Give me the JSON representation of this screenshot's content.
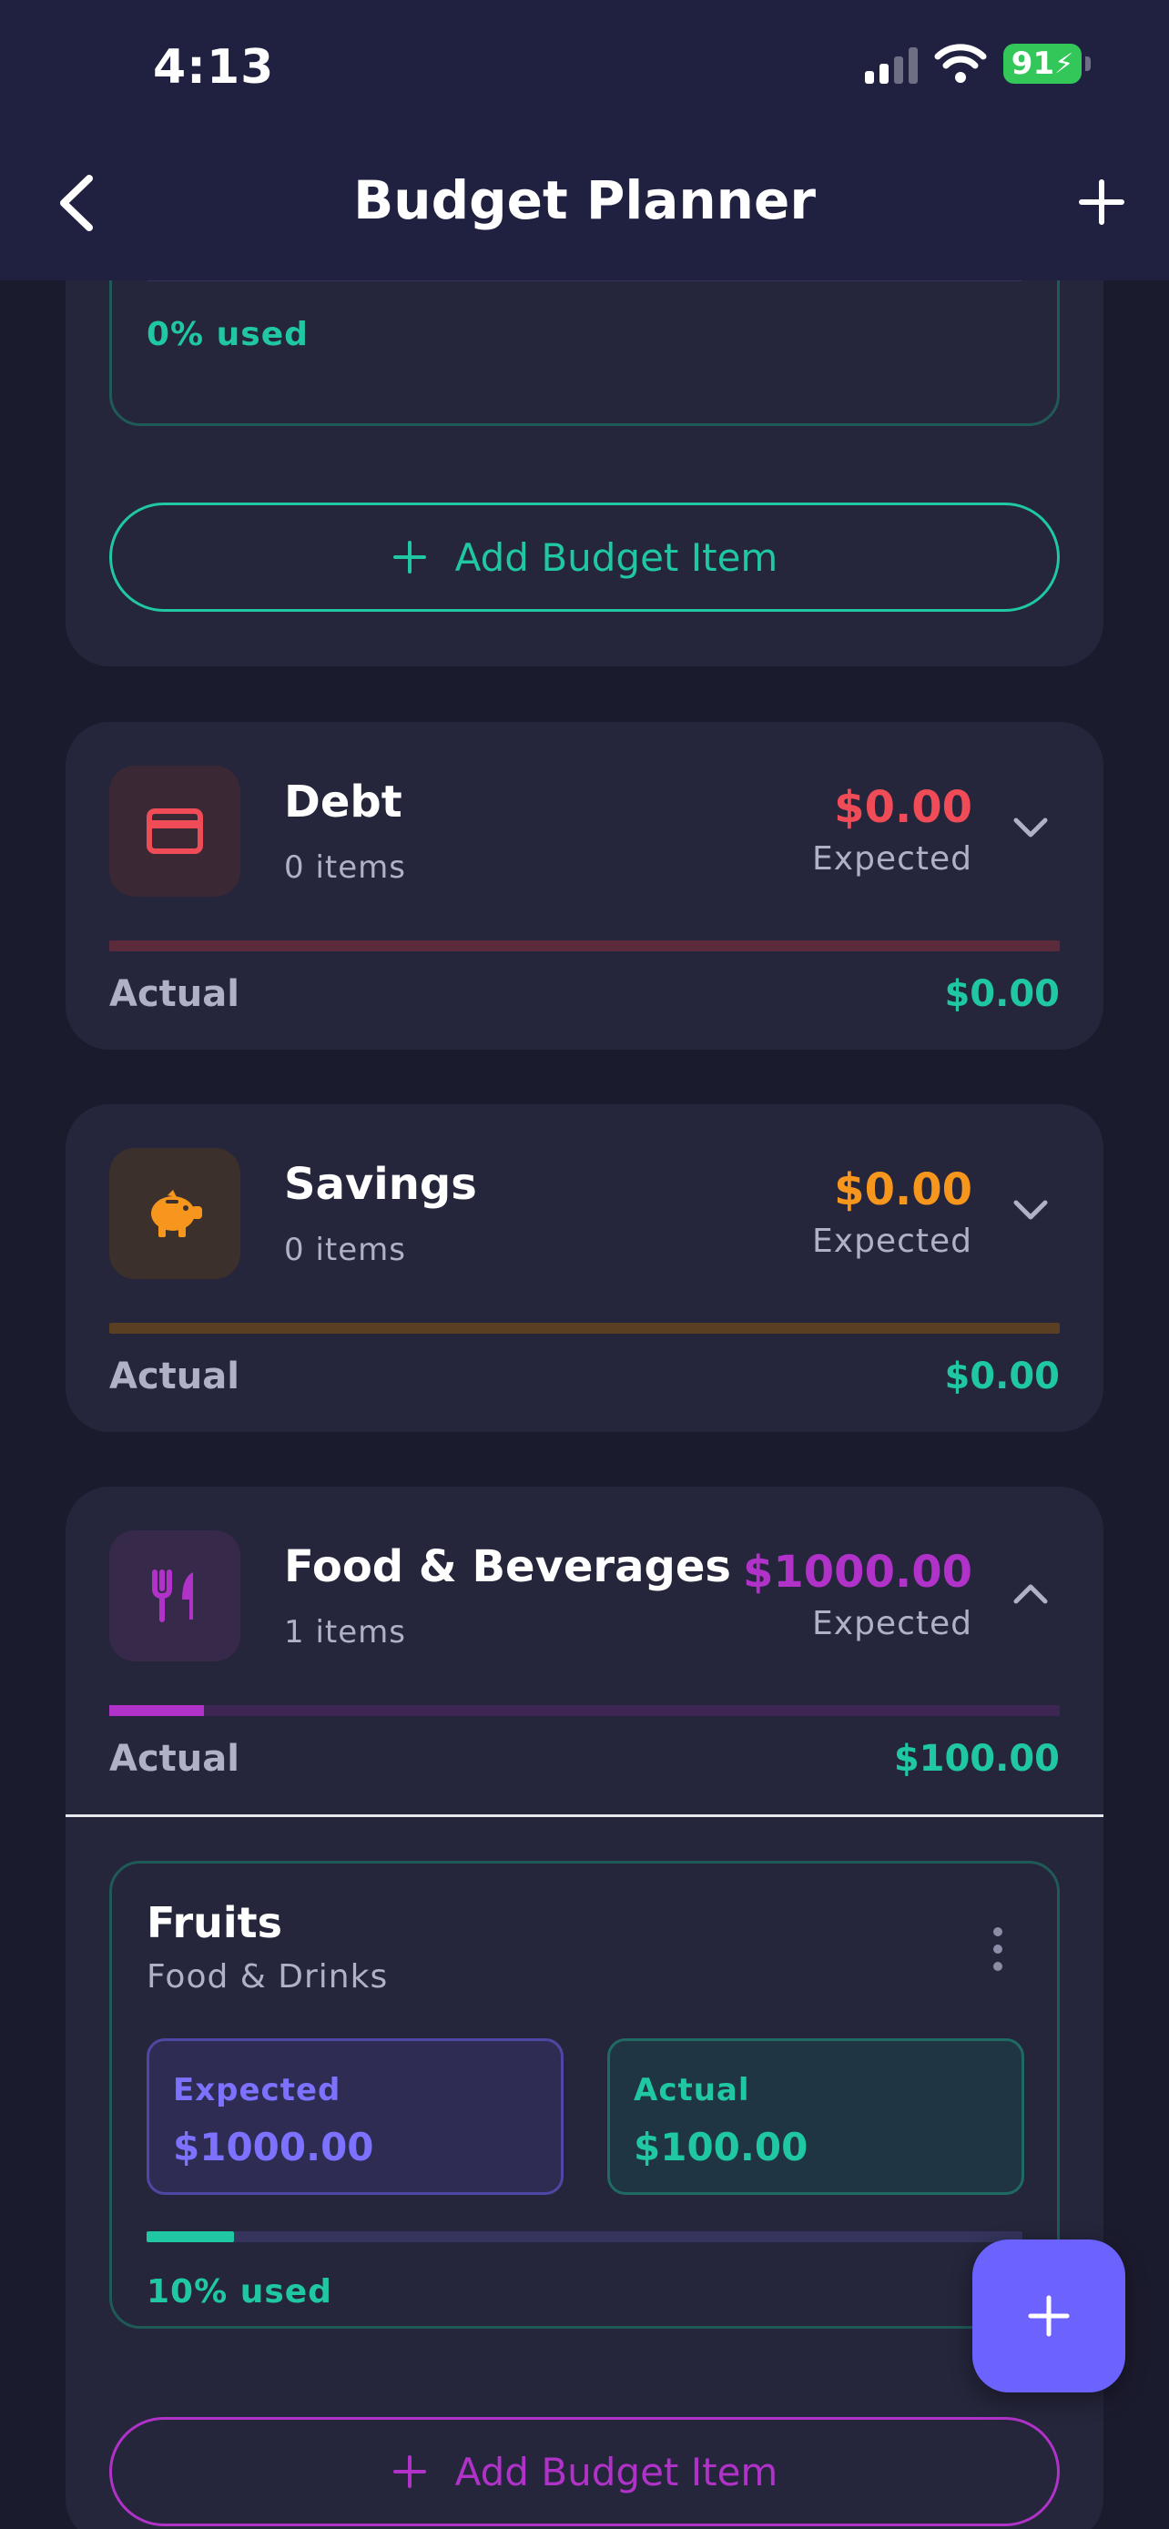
{
  "status_bar": {
    "time": "4:13",
    "battery": "91"
  },
  "nav": {
    "title": "Budget Planner",
    "back_icon": "chevron-left-icon",
    "add_icon": "plus-icon"
  },
  "top_partial": {
    "used_text": "0% used",
    "add_label": "Add Budget Item"
  },
  "categories": [
    {
      "name": "Debt",
      "count": "0 items",
      "expected": "$0.00",
      "expected_label": "Expected",
      "actual_label": "Actual",
      "actual": "$0.00",
      "icon": "credit-card-icon",
      "accent": "#ef4c57",
      "progress": 0,
      "expanded": false
    },
    {
      "name": "Savings",
      "count": "0 items",
      "expected": "$0.00",
      "expected_label": "Expected",
      "actual_label": "Actual",
      "actual": "$0.00",
      "icon": "piggy-bank-icon",
      "accent": "#f7961d",
      "progress": 0,
      "expanded": false
    },
    {
      "name": "Food & Beverages",
      "count": "1 items",
      "expected": "$1000.00",
      "expected_label": "Expected",
      "actual_label": "Actual",
      "actual": "$100.00",
      "icon": "fork-knife-icon",
      "accent": "#b032c8",
      "progress": 0.1,
      "expanded": true,
      "items": [
        {
          "name": "Fruits",
          "category": "Food & Drinks",
          "expected_label": "Expected",
          "expected": "$1000.00",
          "actual_label": "Actual",
          "actual": "$100.00",
          "used_text": "10% used",
          "progress": 0.1
        }
      ],
      "add_label": "Add Budget Item"
    }
  ],
  "colors": {
    "accent_teal": "#1fc8a2",
    "accent_purple": "#6c63ff",
    "background": "#1b1b2e",
    "card": "#25253b"
  },
  "fab_icon": "plus-icon"
}
